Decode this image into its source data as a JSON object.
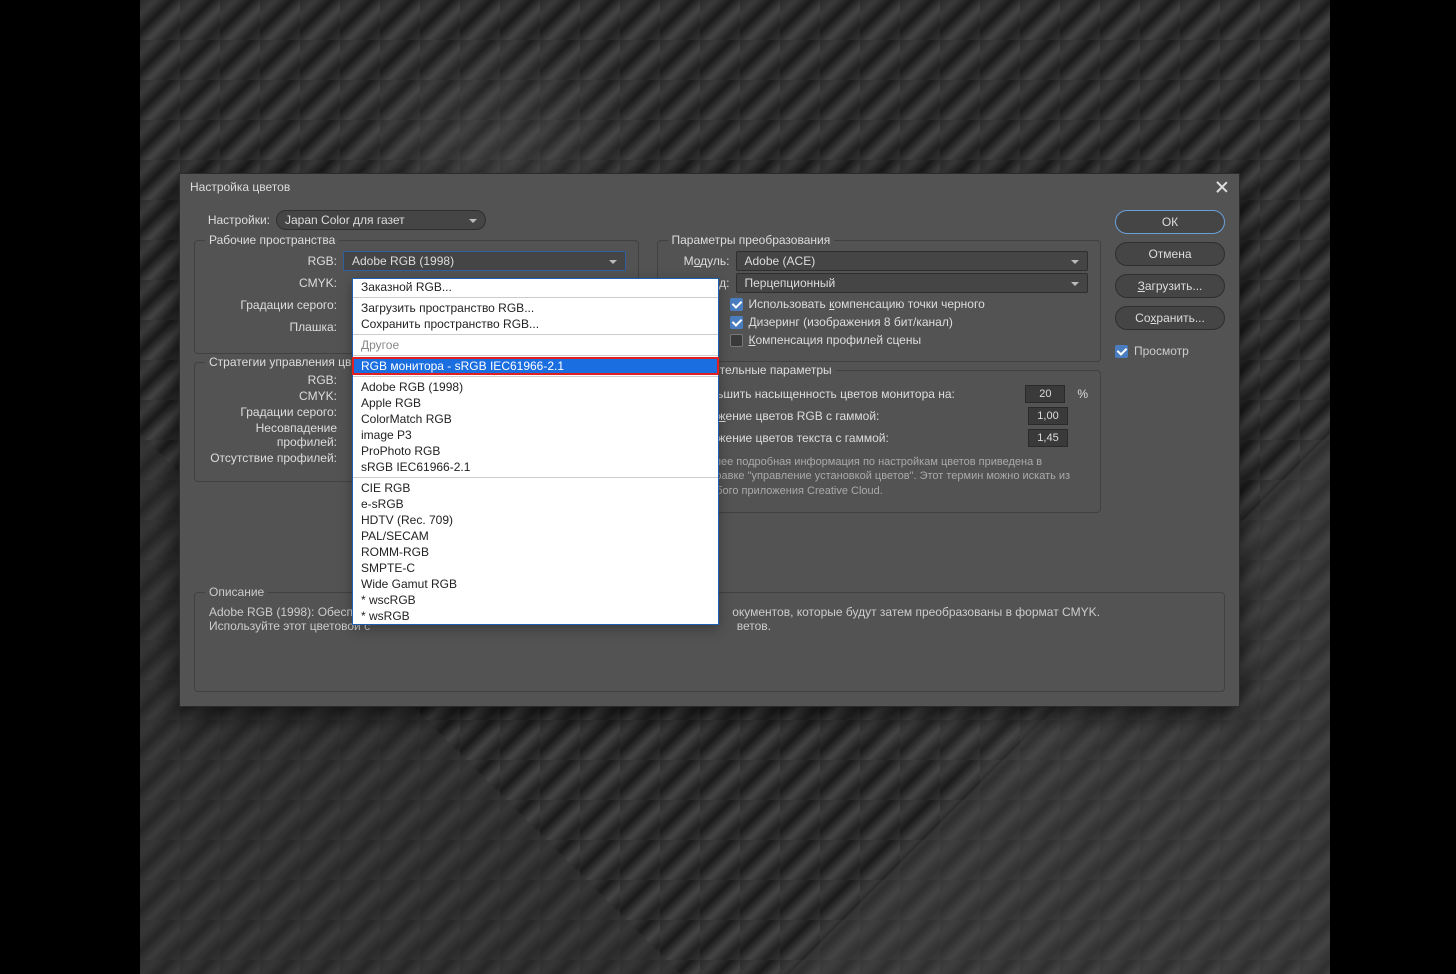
{
  "dialog": {
    "title": "Настройка цветов",
    "settings_label": "Настройки:",
    "settings_value": "Japan Color для газет"
  },
  "buttons": {
    "ok": "ОК",
    "cancel": "Отмена",
    "load": "Загрузить...",
    "save": "Сохранить...",
    "preview": "Просмотр"
  },
  "workspaces": {
    "legend": "Рабочие пространства",
    "rgb_label": "RGB:",
    "rgb_value": "Adobe RGB (1998)",
    "cmyk_label": "CMYK:",
    "gray_label": "Градации серого:",
    "spot_label": "Плашка:"
  },
  "policies": {
    "legend": "Стратегии управления цв",
    "rgb_label": "RGB:",
    "cmyk_label": "CMYK:",
    "gray_label": "Градации серого:",
    "mismatch_label": "Несовпадение профилей:",
    "missing_label": "Отсутствие профилей:"
  },
  "conversion": {
    "legend": "Параметры преобразования",
    "engine_label": "Модуль:",
    "engine_value": "Adobe (ACE)",
    "intent_label": "Метод:",
    "intent_value": "Перцепционный",
    "bpc": "Использовать компенсацию точки черного",
    "dither": "Дизеринг (изображения 8 бит/канал)",
    "scene_comp": "Компенсация профилей сцены"
  },
  "advanced": {
    "legend": "Дополнительные параметры",
    "desat": "Уменьшить насыщенность цветов монитора на:",
    "desat_value": "20",
    "desat_unit": "%",
    "blend_rgb": "Наложение цветов RGB с гаммой:",
    "blend_rgb_value": "1,00",
    "blend_text": "Наложение цветов текста с гаммой:",
    "blend_text_value": "1,45",
    "help": "Более подробная информация по настройкам цветов приведена в Справке \"управление установкой цветов\". Этот термин можно искать из любого приложения Creative Cloud."
  },
  "description": {
    "legend": "Описание",
    "line1_prefix": "Adobe RGB (1998):  Обеспеч",
    "line1_suffix": "окументов, которые будут затем преобразованы в формат CMYK.",
    "line2_prefix": "Используйте этот цветовой с",
    "line2_suffix": "ветов."
  },
  "dropdown": {
    "custom": "Заказной RGB...",
    "load": "Загрузить пространство RGB...",
    "save": "Сохранить пространство RGB...",
    "other": "Другое",
    "selected": "RGB монитора - sRGB IEC61966-2.1",
    "group2": [
      "Adobe RGB (1998)",
      "Apple RGB",
      "ColorMatch RGB",
      "image P3",
      "ProPhoto RGB",
      "sRGB IEC61966-2.1"
    ],
    "group3": [
      "CIE RGB",
      "e-sRGB",
      "HDTV (Rec. 709)",
      "PAL/SECAM",
      "ROMM-RGB",
      "SMPTE-C",
      "Wide Gamut RGB",
      "* wscRGB",
      "* wsRGB"
    ]
  }
}
